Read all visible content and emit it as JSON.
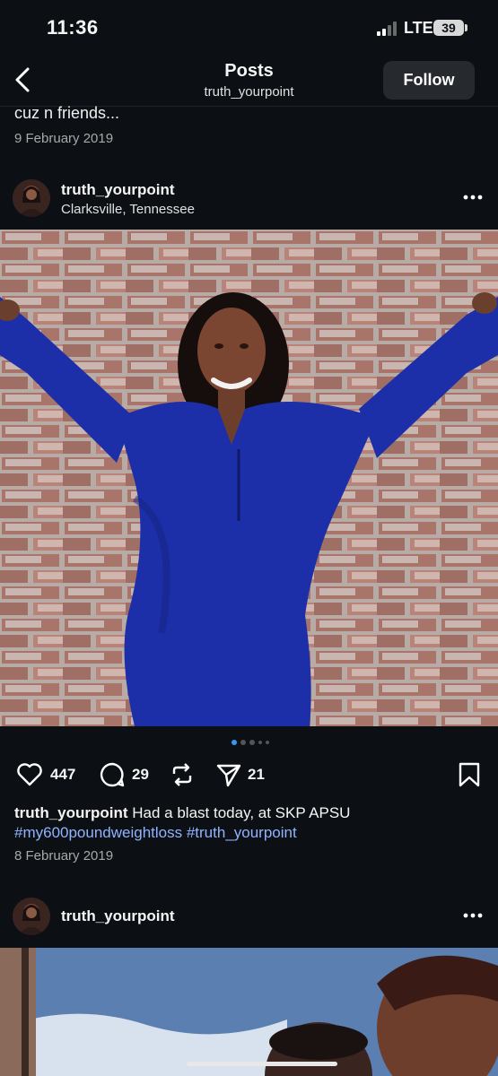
{
  "status_bar": {
    "time": "11:36",
    "network": "LTE",
    "battery": "39"
  },
  "nav": {
    "title": "Posts",
    "subtitle": "truth_yourpoint",
    "follow_label": "Follow"
  },
  "previous_post": {
    "caption_tail": "cuz n friends...",
    "date": "9 February 2019"
  },
  "post": {
    "username": "truth_yourpoint",
    "location": "Clarksville, Tennessee",
    "likes": "447",
    "comments": "29",
    "shares": "21",
    "caption_user": "truth_yourpoint",
    "caption_text": " Had a blast today, at SKP APSU",
    "caption_tags": "#my600poundweightloss #truth_yourpoint",
    "date": "8 February 2019",
    "carousel_count": 5,
    "carousel_active": 1
  },
  "next_post": {
    "username": "truth_yourpoint"
  },
  "colors": {
    "background": "#0c1014",
    "accent": "#3897f0",
    "hashtag": "#8fb3ff",
    "dress": "#1c2fa8"
  }
}
